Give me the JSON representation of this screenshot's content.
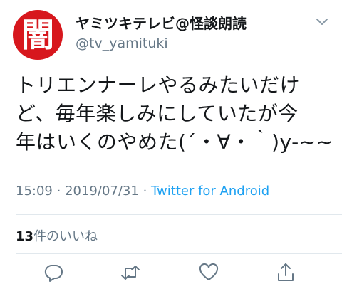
{
  "tweet": {
    "display_name": "ヤミツキテレビ@怪談朗読",
    "username": "@tv_yamituki",
    "avatar_char": "闇",
    "text_lines": [
      "トリエンナーレやるみたいだけ",
      "ど、毎年楽しみにしていたが今",
      "年はいくのやめた(´・∀・｀)y-~~"
    ],
    "time": "15:09",
    "date": "2019/07/31",
    "separator": "·",
    "source": "Twitter for Android",
    "like_count": "13",
    "like_label": "件のいいね"
  },
  "colors": {
    "avatar_bg": "#d7171d",
    "text": "#14171a",
    "secondary": "#657786",
    "link": "#1da1f2",
    "divider": "#e1e8ed"
  },
  "icons": [
    "chevron-down-icon",
    "reply-icon",
    "retweet-icon",
    "like-icon",
    "share-icon"
  ]
}
